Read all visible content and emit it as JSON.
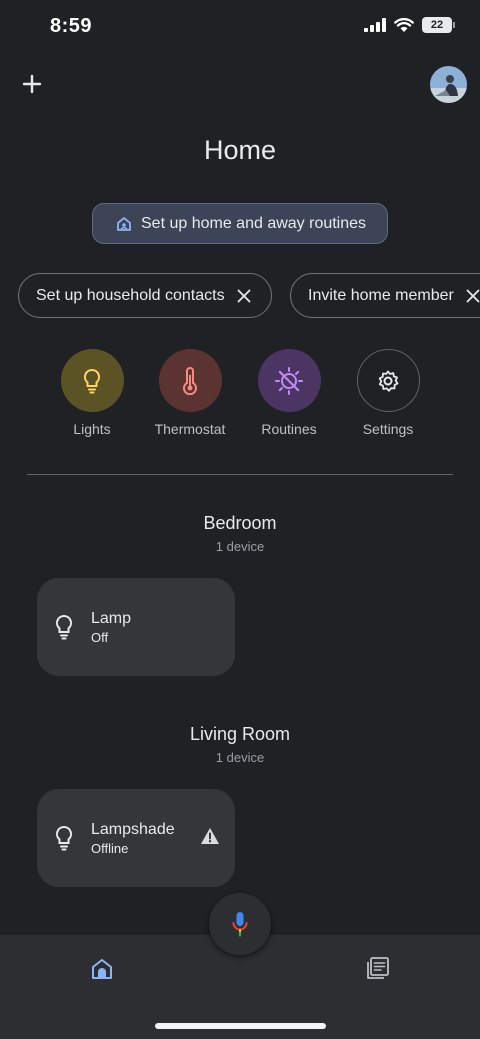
{
  "status_bar": {
    "time": "8:59",
    "battery": "22"
  },
  "header": {
    "title": "Home"
  },
  "routine_chip": {
    "label": "Set up home and away routines"
  },
  "suggestion_chips": [
    {
      "label": "Set up household contacts"
    },
    {
      "label": "Invite home member"
    }
  ],
  "favorites": [
    {
      "label": "Lights",
      "icon": "lightbulb-icon",
      "color": "#fdd663",
      "bg": "#5c5325"
    },
    {
      "label": "Thermostat",
      "icon": "thermometer-icon",
      "color": "#f28b82",
      "bg": "#5b3432"
    },
    {
      "label": "Routines",
      "icon": "routine-icon",
      "color": "#c58af9",
      "bg": "#4a3563"
    },
    {
      "label": "Settings",
      "icon": "gear-icon",
      "color": "#e8eaed",
      "bg": "#202124"
    }
  ],
  "rooms": [
    {
      "name": "Bedroom",
      "device_count": "1 device",
      "devices": [
        {
          "name": "Lamp",
          "state": "Off"
        }
      ]
    },
    {
      "name": "Living Room",
      "device_count": "1 device",
      "devices": [
        {
          "name": "Lampshade",
          "state": "Offline"
        }
      ]
    }
  ],
  "colors": {
    "accent": "#8ab4f8",
    "background": "#202124",
    "card": "#35363a"
  }
}
